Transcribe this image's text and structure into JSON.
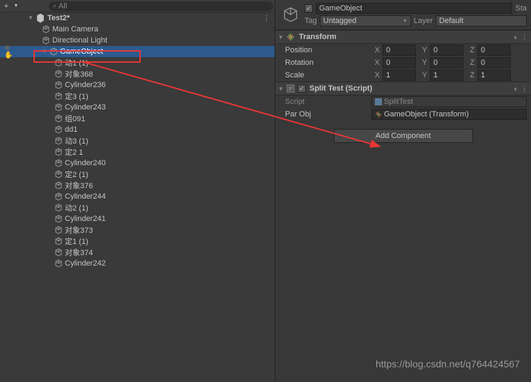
{
  "toolbar": {
    "search_placeholder": "All"
  },
  "hierarchy": {
    "scene_name": "Test2*",
    "items": [
      {
        "label": "Main Camera",
        "indent": 0
      },
      {
        "label": "Directional Light",
        "indent": 0
      },
      {
        "label": "GameObject",
        "indent": 0,
        "selected": true,
        "expanded": true
      },
      {
        "label": "动1 (1)",
        "indent": 1
      },
      {
        "label": "对象368",
        "indent": 1
      },
      {
        "label": "Cylinder236",
        "indent": 1
      },
      {
        "label": "定3 (1)",
        "indent": 1
      },
      {
        "label": "Cylinder243",
        "indent": 1
      },
      {
        "label": "组091",
        "indent": 1
      },
      {
        "label": "dd1",
        "indent": 1
      },
      {
        "label": "动3 (1)",
        "indent": 1
      },
      {
        "label": "定2 1",
        "indent": 1
      },
      {
        "label": "Cylinder240",
        "indent": 1
      },
      {
        "label": "定2 (1)",
        "indent": 1
      },
      {
        "label": "对象376",
        "indent": 1
      },
      {
        "label": "Cylinder244",
        "indent": 1
      },
      {
        "label": "动2 (1)",
        "indent": 1
      },
      {
        "label": "Cylinder241",
        "indent": 1
      },
      {
        "label": "对象373",
        "indent": 1
      },
      {
        "label": "定1 (1)",
        "indent": 1
      },
      {
        "label": "对象374",
        "indent": 1
      },
      {
        "label": "Cylinder242",
        "indent": 1
      }
    ]
  },
  "inspector": {
    "object_name": "GameObject",
    "static_label": "Sta",
    "tag_label": "Tag",
    "tag_value": "Untagged",
    "layer_label": "Layer",
    "layer_value": "Default",
    "transform": {
      "title": "Transform",
      "rows": [
        {
          "label": "Position",
          "x": "0",
          "y": "0",
          "z": "0"
        },
        {
          "label": "Rotation",
          "x": "0",
          "y": "0",
          "z": "0"
        },
        {
          "label": "Scale",
          "x": "1",
          "y": "1",
          "z": "1"
        }
      ]
    },
    "script_comp": {
      "title": "Split Test (Script)",
      "script_label": "Script",
      "script_value": "SplitTest",
      "parobj_label": "Par Obj",
      "parobj_value": "GameObject (Transform)"
    },
    "add_component": "Add Component"
  },
  "watermark": "https://blog.csdn.net/q764424567"
}
